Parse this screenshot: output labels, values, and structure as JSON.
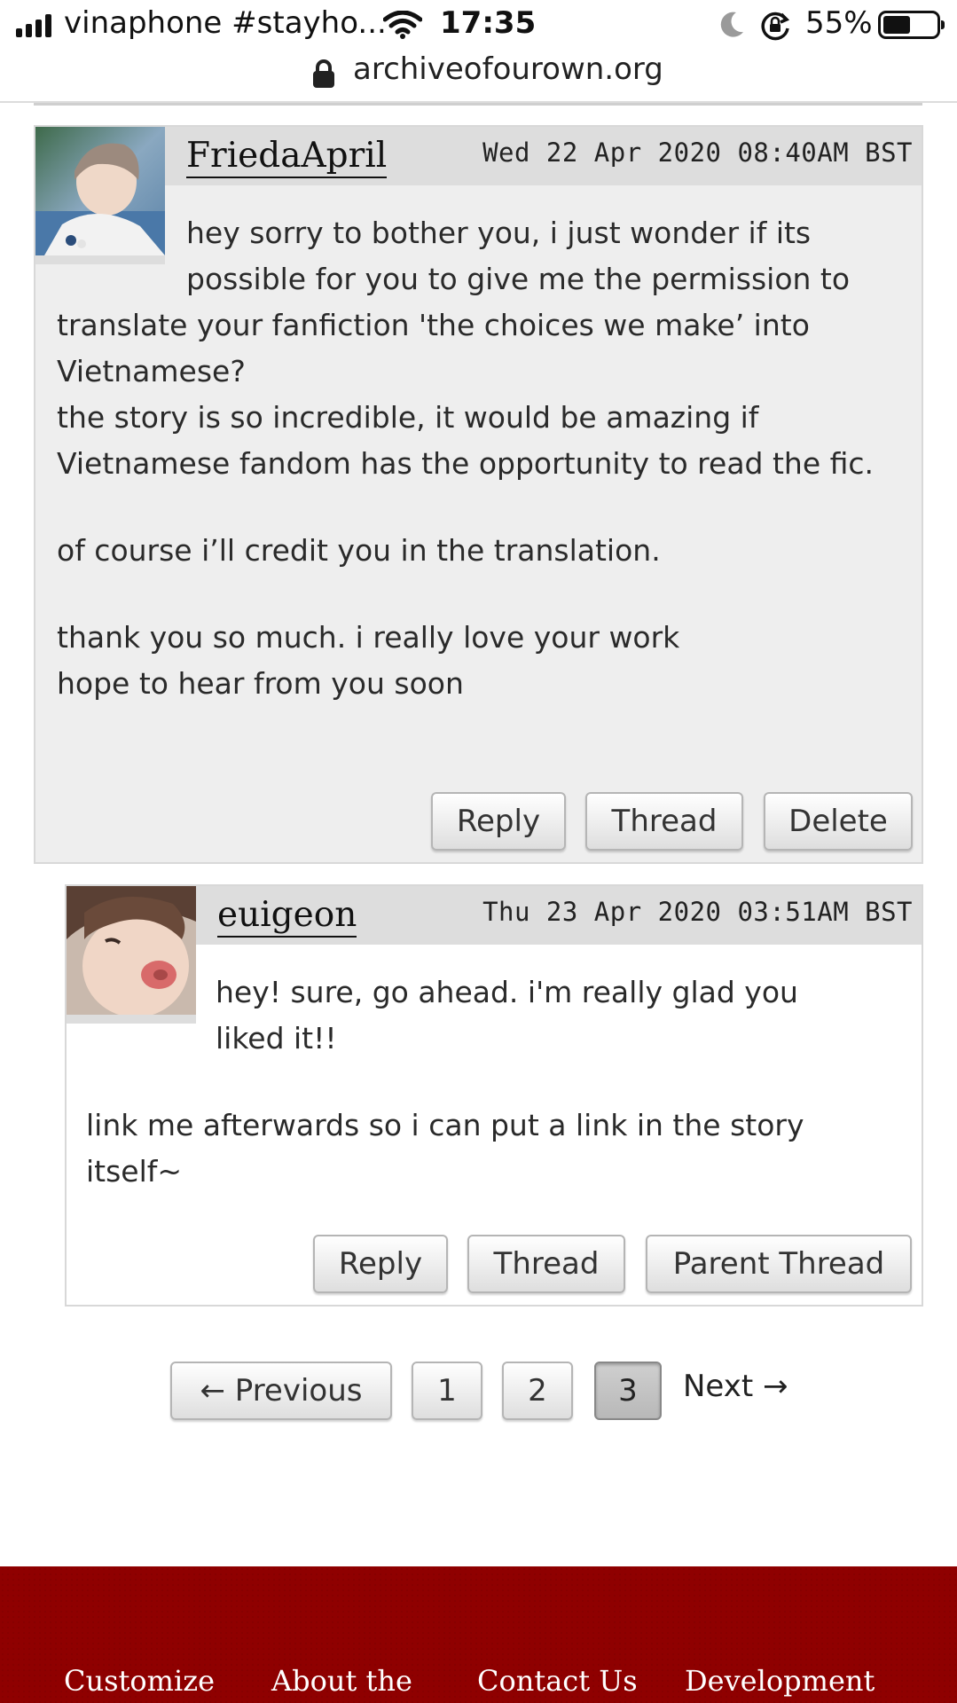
{
  "status_bar": {
    "carrier": "vinaphone #stayho...",
    "time": "17:35",
    "battery": "55%",
    "battery_level": 0.55,
    "icons": [
      "signal-icon",
      "wifi-icon",
      "moon-icon",
      "rotation-lock-icon",
      "battery-icon"
    ]
  },
  "url_bar": {
    "url": "archiveofourown.org",
    "icon": "lock-icon"
  },
  "comments": [
    {
      "author": "FriedaApril",
      "date": "Wed 22 Apr 2020 08:40AM BST",
      "paragraphs": {
        "p1a": "hey sorry to bother you, i just wonder if its",
        "p1b": "possible for you to give me the permission to",
        "p1c": "translate your fanfiction 'the choices we make’ into Vietnamese?",
        "p2": "the story is so incredible, it would be amazing if Vietnamese fandom has the opportunity to read the fic.",
        "p3": "of course i’ll credit you in the translation.",
        "p4a": "thank you so much. i really love your work",
        "p4b": "hope to hear from you soon"
      },
      "buttons": {
        "reply": "Reply",
        "thread": "Thread",
        "delete": "Delete"
      }
    },
    {
      "author": "euigeon",
      "date": "Thu 23 Apr 2020 03:51AM BST",
      "paragraphs": {
        "p1a": "hey! sure, go ahead. i'm really glad you",
        "p1b": "liked it!!",
        "p2": "link me afterwards so i can put a link in the story itself~"
      },
      "buttons": {
        "reply": "Reply",
        "thread": "Thread",
        "parent_thread": "Parent Thread"
      }
    }
  ],
  "pagination": {
    "previous": "← Previous",
    "pages": [
      "1",
      "2",
      "3"
    ],
    "current": "3",
    "next": "Next →"
  },
  "footer": {
    "links": [
      "Customize",
      "About the",
      "Contact Us",
      "Development"
    ],
    "color": "#8f0000"
  }
}
